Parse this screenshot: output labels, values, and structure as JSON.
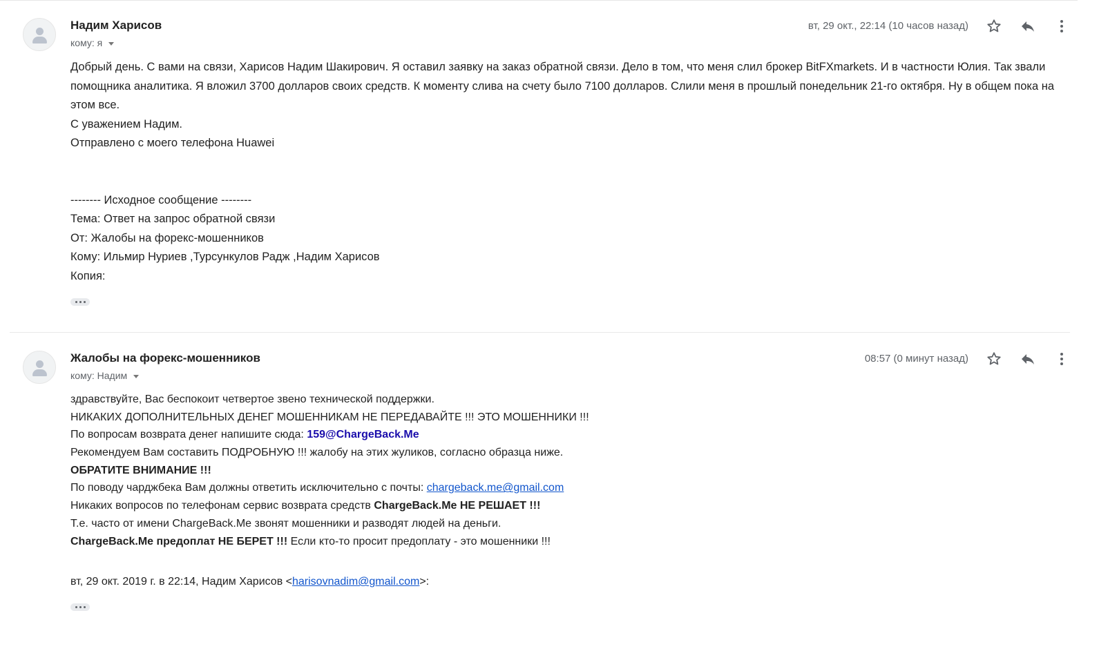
{
  "messages": [
    {
      "sender": "Надим Харисов",
      "to_label": "кому: я",
      "date": "вт, 29 окт., 22:14 (10 часов назад)",
      "body_wrapped": "Добрый день. С вами на связи, Харисов Надим Шакирович. Я оставил заявку на заказ обратной связи. Дело в том, что меня слил брокер BitFXmarkets. И в частности Юлия. Так звали помощника аналитика. Я вложил 3700 долларов своих средств. К моменту слива на счету было 7100 долларов. Слили меня в прошлый понедельник 21-го октября. Ну в общем пока на этом все.",
      "regards": "С уважением Надим.",
      "signature": "Отправлено с моего телефона Huawei",
      "original_header": "-------- Исходное сообщение --------",
      "subject_line": "Тема: Ответ на запрос обратной связи",
      "from_line": "От: Жалобы на форекс-мошенников",
      "to_line": "Кому: Ильмир Нуриев ,Турсункулов Радж ,Надим Харисов",
      "cc_line": "Копия:"
    },
    {
      "sender": "Жалобы на форекс-мошенников",
      "to_label": "кому: Надим",
      "date": "08:57 (0 минут назад)",
      "line1": "здравствуйте, Вас беспокоит четвертое звено технической поддержки.",
      "line2": "НИКАКИХ ДОПОЛНИТЕЛЬНЫХ ДЕНЕГ МОШЕННИКАМ НЕ ПЕРЕДАВАЙТЕ !!! ЭТО МОШЕННИКИ !!!",
      "line3_text": "По вопросам возврата денег напишите сюда: ",
      "line3_email": "159@ChargeBack.Me",
      "line4": "Рекомендуем Вам составить ПОДРОБНУЮ !!! жалобу на этих жуликов, согласно образца ниже.",
      "line5": "ОБРАТИТЕ ВНИМАНИЕ !!!",
      "line6_text": "По поводу чарджбека Вам должны ответить исключительно с почты: ",
      "line6_link": "chargeback.me@gmail.com",
      "line7_text": "Никаких вопросов по телефонам сервис возврата средств ",
      "line7_bold": "ChargeBack.Me НЕ РЕШАЕТ !!!",
      "line8": "Т.е. часто от имени ChargeBack.Me звонят мошенники и разводят людей на деньги.",
      "line9_bold": "ChargeBack.Me предоплат НЕ БЕРЕТ !!!",
      "line9_text": " Если кто-то просит предоплату - это мошенники !!!",
      "quote_prefix": "вт, 29 окт. 2019 г. в 22:14, Надим Харисов <",
      "quote_email": "harisovnadim@gmail.com",
      "quote_suffix": ">:"
    }
  ],
  "icons": {
    "star": "star-icon",
    "reply": "reply-icon",
    "more": "more-vert-icon",
    "avatar": "person-icon"
  },
  "colors": {
    "link": "#1155cc",
    "email_highlight": "#1a0dab",
    "meta": "#5f6368"
  }
}
